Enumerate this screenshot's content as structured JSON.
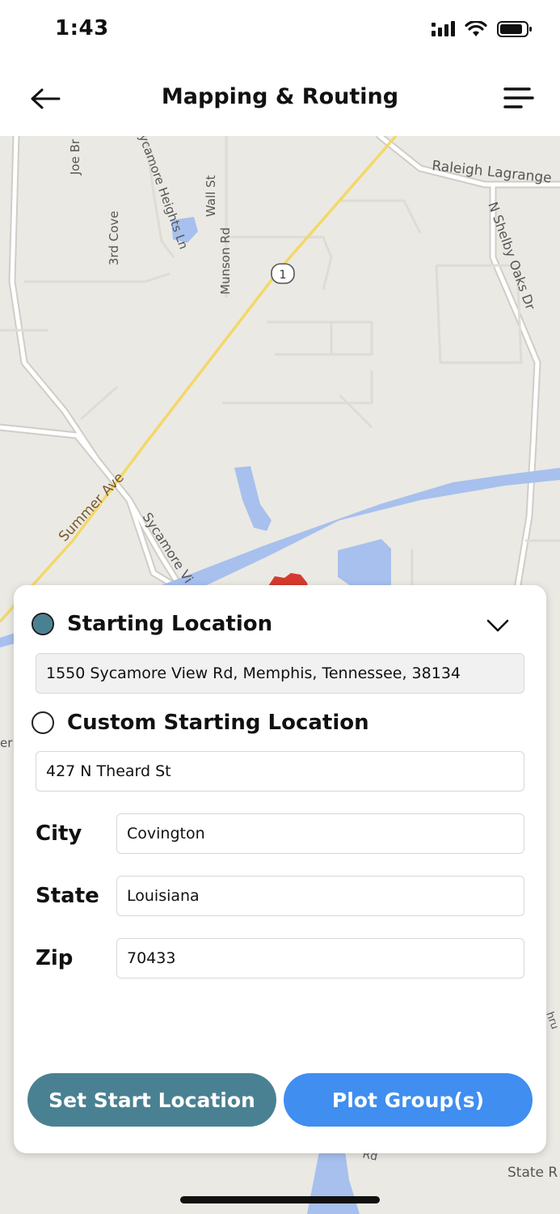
{
  "status": {
    "time": "1:43"
  },
  "header": {
    "title": "Mapping & Routing"
  },
  "map": {
    "labels": {
      "joe": "Joe Br",
      "sycamore_heights": "ycamore Heights Ln",
      "wall": "Wall St",
      "third_cove": "3rd Cove",
      "munson": "Munson Rd",
      "shield": "1",
      "raleigh": "Raleigh Lagrange",
      "shelby": "N Shelby Oaks Dr",
      "summer": "Summer Ave",
      "sycamore_view": "Sycamore Vi",
      "state_rd": "State R",
      "rd": "Rd",
      "left_edge": "er",
      "right_edge": "hru"
    },
    "colors": {
      "land": "#ebe9e3",
      "road": "#ffffff",
      "road_outline": "#cfcdc6",
      "highway": "#f3d86a",
      "water": "#a7c0ee",
      "marker": "#d63a2f"
    }
  },
  "panel": {
    "starting_location": {
      "label": "Starting Location",
      "selected": true,
      "address": "1550 Sycamore View Rd, Memphis, Tennessee, 38134"
    },
    "custom_location": {
      "label": "Custom Starting Location",
      "selected": false,
      "street": "427 N Theard St"
    },
    "fields": {
      "city_label": "City",
      "city_value": "Covington",
      "state_label": "State",
      "state_value": "Louisiana",
      "zip_label": "Zip",
      "zip_value": "70433"
    },
    "buttons": {
      "set_start": "Set Start Location",
      "plot_groups": "Plot Group(s)"
    }
  },
  "theme": {
    "primary": "#4a8192",
    "accent": "#3f8ef0"
  }
}
